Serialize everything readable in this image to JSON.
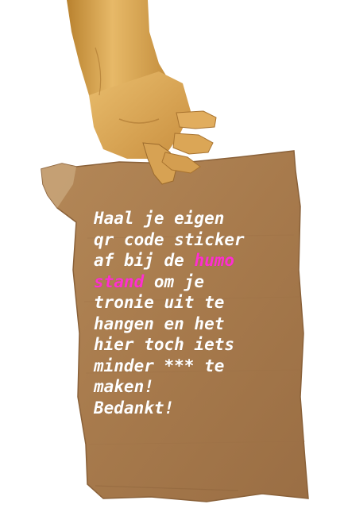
{
  "sign": {
    "line1": "Haal je eigen",
    "line2": "qr code sticker",
    "line3_pre": "af bij de ",
    "line3_hl": "humo",
    "line4_hl": "stand",
    "line4_post": " om je",
    "line5": "tronie uit te",
    "line6": "hangen en het",
    "line7": "hier toch iets",
    "line8": "minder *** te",
    "line9": "maken!",
    "line10": "Bedankt!"
  },
  "colors": {
    "text": "#ffffff",
    "highlight": "#ff2fd0",
    "cardboard": "#a97b4f",
    "hand": "#d9a24e"
  },
  "icons": {
    "hand": "hand-holding-icon",
    "cardboard": "cardboard-sign"
  }
}
